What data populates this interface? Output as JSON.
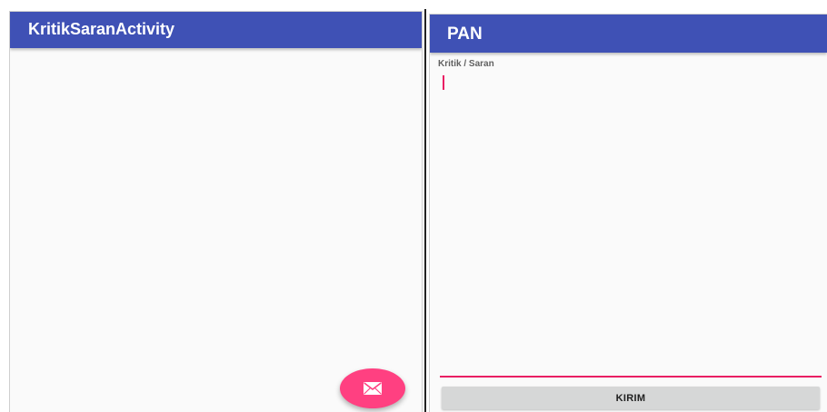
{
  "left_screen": {
    "app_bar": {
      "title": "KritikSaranActivity"
    },
    "fab": {
      "icon": "envelope-icon",
      "color": "#ff4081"
    }
  },
  "right_screen": {
    "app_bar": {
      "title": "PAN"
    },
    "form": {
      "label": "Kritik / Saran",
      "input_value": "",
      "submit_label": "KIRIM"
    }
  },
  "colors": {
    "primary": "#3f51b5",
    "accent": "#ff4081",
    "input_underline": "#e91e63",
    "button_bg": "#d6d7d7"
  }
}
